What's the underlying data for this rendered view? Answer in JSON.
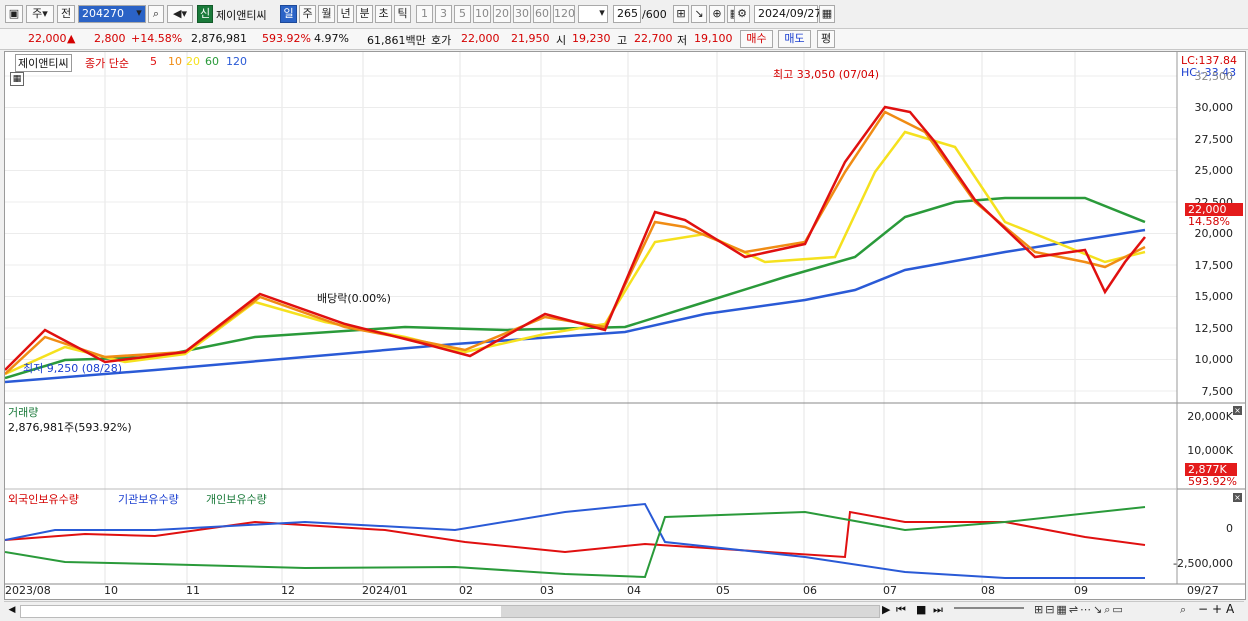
{
  "toolbar": {
    "market_label": "주",
    "prev_label": "전",
    "code": "204270",
    "new_badge": "신",
    "stock_name": "제이앤티씨",
    "periods": [
      "일",
      "주",
      "월",
      "년",
      "분",
      "초",
      "틱"
    ],
    "intervals": [
      "1",
      "3",
      "5",
      "10",
      "20",
      "30",
      "60",
      "120"
    ],
    "count_value": "265",
    "count_total": "/600",
    "date": "2024/09/27"
  },
  "quote": {
    "price": "22,000",
    "change": "2,800",
    "change_pct": "+14.58%",
    "volume": "2,876,981",
    "volume_ratio": "593.92%",
    "turnover_pct": "4.97%",
    "amount": "61,861백만",
    "bid_label": "호가",
    "bid1": "22,000",
    "bid2": "21,950",
    "open_label": "시",
    "open": "19,230",
    "high_label": "고",
    "high": "22,700",
    "low_label": "저",
    "low": "19,100",
    "buy_label": "매수",
    "sell_label": "매도",
    "eval_label": "평"
  },
  "price_panel": {
    "name_tag": "제이앤티씨",
    "legend_prefix": "종가 단순",
    "ma_labels": [
      "5",
      "10",
      "20",
      "60",
      "120"
    ],
    "ma_colors": [
      "#e01010",
      "#f08c14",
      "#f5e11e",
      "#2a9a3a",
      "#2a5ad6"
    ],
    "high_note": "최고 33,050 (07/04)",
    "low_note": "최저 9,250 (08/28)",
    "dividend_note": "배당락(0.00%)",
    "lc_label": "LC:137.84",
    "hc_label": "HC:-33.43",
    "y_ticks": [
      "32,500",
      "30,000",
      "27,500",
      "25,000",
      "22,500",
      "20,000",
      "17,500",
      "15,000",
      "12,500",
      "10,000",
      "7,500"
    ],
    "last_price_tag": "22,000",
    "last_pct_tag": "14.58%"
  },
  "volume_panel": {
    "title": "거래량",
    "value": "2,876,981주(593.92%)",
    "y_ticks": [
      "20,000K",
      "10,000K"
    ],
    "last_tag": "2,877K",
    "last_pct": "593.92%"
  },
  "holder_panel": {
    "legend": [
      "외국인보유수량",
      "기관보유수량",
      "개인보유수량"
    ],
    "colors": [
      "#e01010",
      "#2a5ad6",
      "#2a9a3a"
    ],
    "y_ticks": [
      "0",
      "-2,500,000"
    ]
  },
  "x_axis": [
    "2023/08",
    "10",
    "11",
    "12",
    "2024/01",
    "02",
    "03",
    "04",
    "05",
    "06",
    "07",
    "08",
    "09",
    "09/27"
  ]
}
